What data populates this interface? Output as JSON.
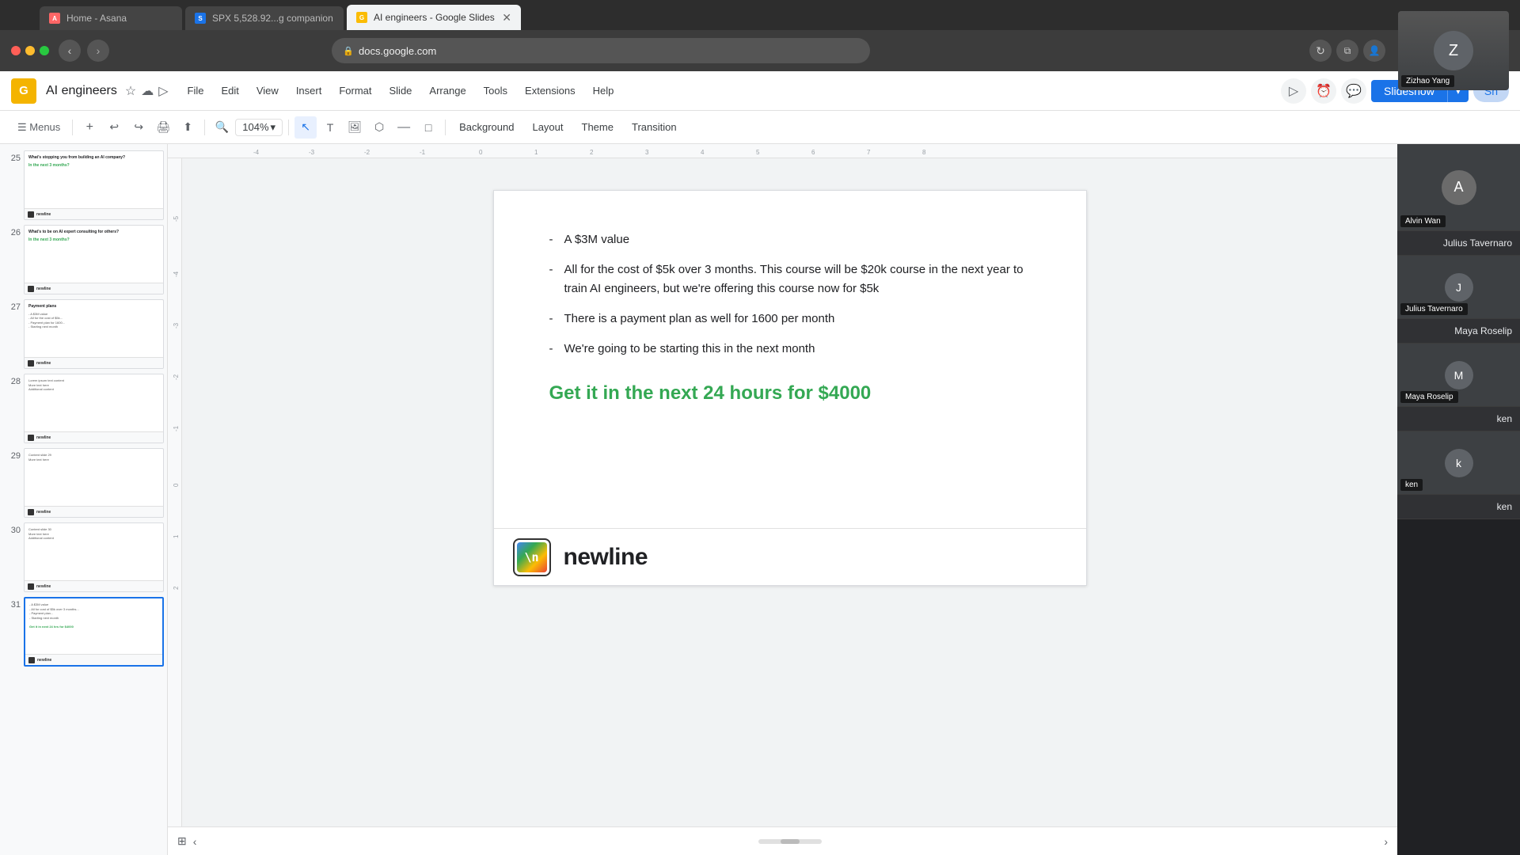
{
  "browser": {
    "url": "docs.google.com",
    "tab_title": "AI engineers - Google Slides",
    "tab_icon": "G",
    "back_disabled": false,
    "forward_disabled": false
  },
  "other_tabs": [
    {
      "label": "Home - Asana",
      "icon": "A"
    },
    {
      "label": "SPX 5,528.92...g companion",
      "icon": "S"
    }
  ],
  "app": {
    "logo": "G",
    "title": "AI engineers",
    "menu_items": [
      "File",
      "Edit",
      "View",
      "Insert",
      "Format",
      "Slide",
      "Arrange",
      "Tools",
      "Extensions",
      "Help"
    ],
    "slideshow_label": "Slideshow",
    "share_label": "Sh",
    "zoom_level": "104%"
  },
  "toolbar": {
    "buttons": [
      "☰",
      "Menus",
      "+",
      "↩",
      "↪",
      "🖨",
      "↕",
      "🔍",
      "104%",
      "▾",
      "↖",
      "T",
      "🖼",
      "⬡",
      "—",
      "□"
    ],
    "text_buttons": [
      "Background",
      "Layout",
      "Theme",
      "Transition"
    ]
  },
  "slides": [
    {
      "number": "25",
      "active": false,
      "title": "What's stopping you from building an AI company?",
      "subtitle": "In the next 3 months?",
      "has_logo": true
    },
    {
      "number": "26",
      "active": false,
      "title": "What's to be on AI expert consulting for others?",
      "subtitle": "In the next 3 months?",
      "has_logo": true
    },
    {
      "number": "27",
      "active": false,
      "title": "Payment plans",
      "has_logo": true
    },
    {
      "number": "28",
      "active": false,
      "title": "",
      "has_logo": true
    },
    {
      "number": "29",
      "active": false,
      "title": "",
      "has_logo": true
    },
    {
      "number": "30",
      "active": false,
      "title": "",
      "has_logo": true
    },
    {
      "number": "31",
      "active": true,
      "title": "",
      "has_logo": true
    }
  ],
  "current_slide": {
    "bullets": [
      "A $3M value",
      "All for the cost of $5k over 3 months. This course will be $20k course in the next year to train AI engineers, but we're offering this course now for $5k",
      "There is a payment plan as well for 1600 per month",
      "We're going to be starting this in the next month"
    ],
    "cta": "Get it in the next 24 hours for $4000",
    "footer_brand": "newline",
    "footer_logo_text": "\\n"
  },
  "participants": [
    {
      "name": "Zizhao Yang",
      "has_video": true,
      "initials": "Z"
    },
    {
      "name": "Alvin Wan",
      "has_video": true,
      "initials": "A"
    },
    {
      "name": "Julius Tavernaro",
      "initials": "J"
    },
    {
      "name": "Julius Tavernaro",
      "initials": "J"
    },
    {
      "name": "Maya Roselip",
      "initials": "M"
    },
    {
      "name": "Maya Roselip",
      "initials": "M"
    },
    {
      "name": "ken",
      "initials": "k"
    },
    {
      "name": "ken",
      "initials": "k"
    }
  ],
  "colors": {
    "green": "#34a853",
    "blue": "#1a73e8",
    "accent": "#f4b400"
  }
}
